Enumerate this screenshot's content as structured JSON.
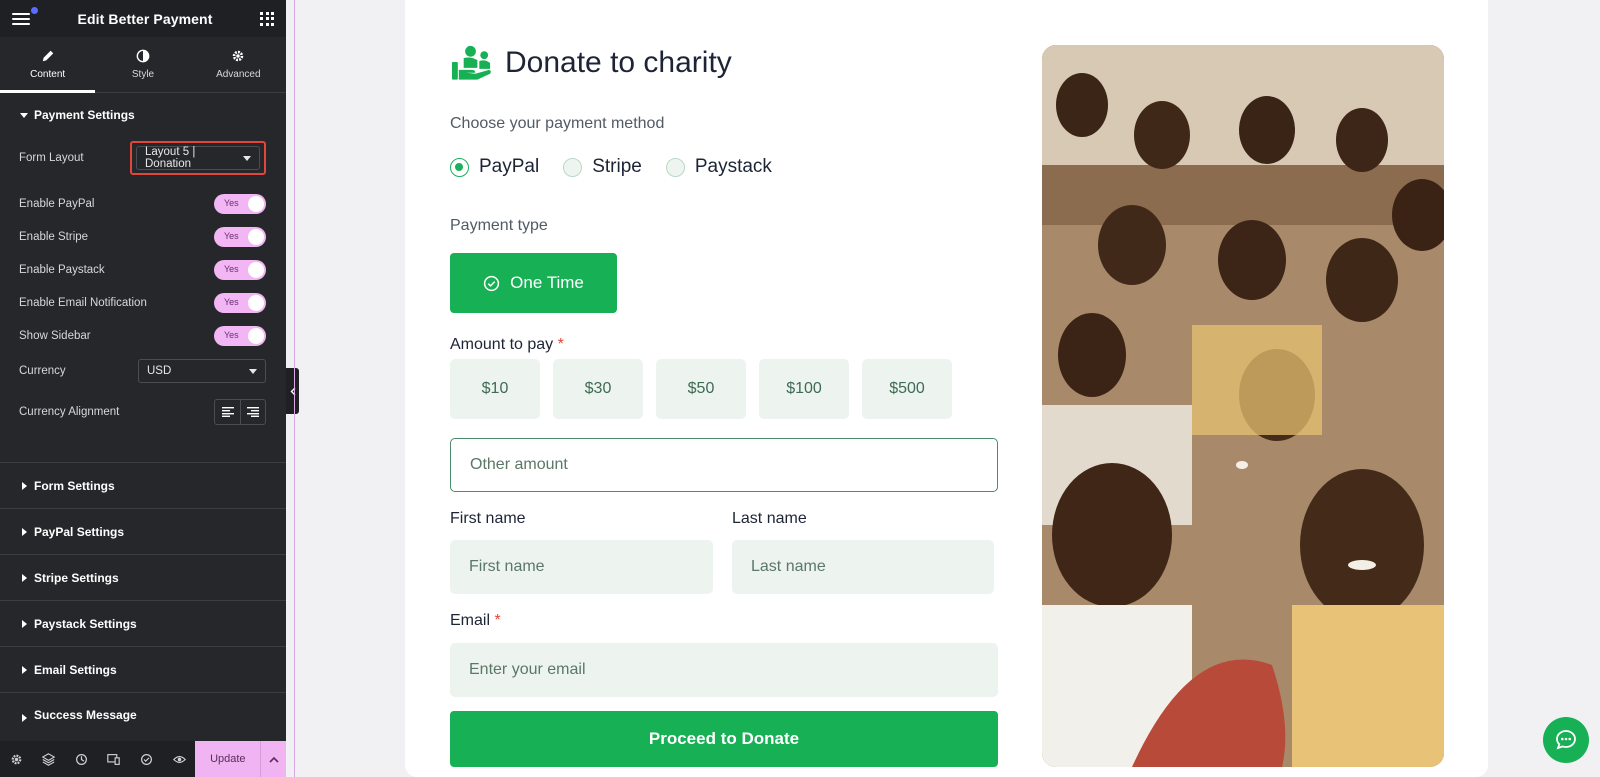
{
  "panel": {
    "title": "Edit Better Payment",
    "tabs": [
      {
        "label": "Content",
        "icon": "pencil-icon"
      },
      {
        "label": "Style",
        "icon": "half-circle-icon"
      },
      {
        "label": "Advanced",
        "icon": "gear-icon"
      }
    ],
    "payment_section": {
      "title": "Payment Settings",
      "form_layout_label": "Form Layout",
      "form_layout_value": "Layout 5 | Donation",
      "toggles": [
        {
          "label": "Enable PayPal",
          "value": "Yes"
        },
        {
          "label": "Enable Stripe",
          "value": "Yes"
        },
        {
          "label": "Enable Paystack",
          "value": "Yes"
        },
        {
          "label": "Enable Email Notification",
          "value": "Yes"
        },
        {
          "label": "Show Sidebar",
          "value": "Yes"
        }
      ],
      "currency_label": "Currency",
      "currency_value": "USD",
      "alignment_label": "Currency Alignment"
    },
    "collapsed_sections": [
      "Form Settings",
      "PayPal Settings",
      "Stripe Settings",
      "Paystack Settings",
      "Email Settings",
      "Success Message"
    ],
    "footer": {
      "icons": [
        "gear-icon",
        "layers-icon",
        "history-icon",
        "responsive-icon",
        "check-icon",
        "eye-icon"
      ],
      "update_label": "Update"
    }
  },
  "form": {
    "title": "Donate to charity",
    "payment_method_label": "Choose your payment method",
    "methods": [
      {
        "label": "PayPal",
        "checked": true
      },
      {
        "label": "Stripe",
        "checked": false
      },
      {
        "label": "Paystack",
        "checked": false
      }
    ],
    "payment_type_label": "Payment type",
    "payment_type_button": "One Time",
    "amount_label": "Amount to pay",
    "required_mark": "*",
    "amounts": [
      "$10",
      "$30",
      "$50",
      "$100",
      "$500"
    ],
    "other_amount_placeholder": "Other amount",
    "first_name_label": "First name",
    "first_name_placeholder": "First name",
    "last_name_label": "Last name",
    "last_name_placeholder": "Last name",
    "email_label": "Email",
    "email_placeholder": "Enter your email",
    "submit_label": "Proceed to Donate"
  },
  "colors": {
    "accent_green": "#17b055",
    "panel_bg": "#26272b",
    "toggle_pink": "#f1b6f3",
    "highlight_red": "#e2463a"
  }
}
